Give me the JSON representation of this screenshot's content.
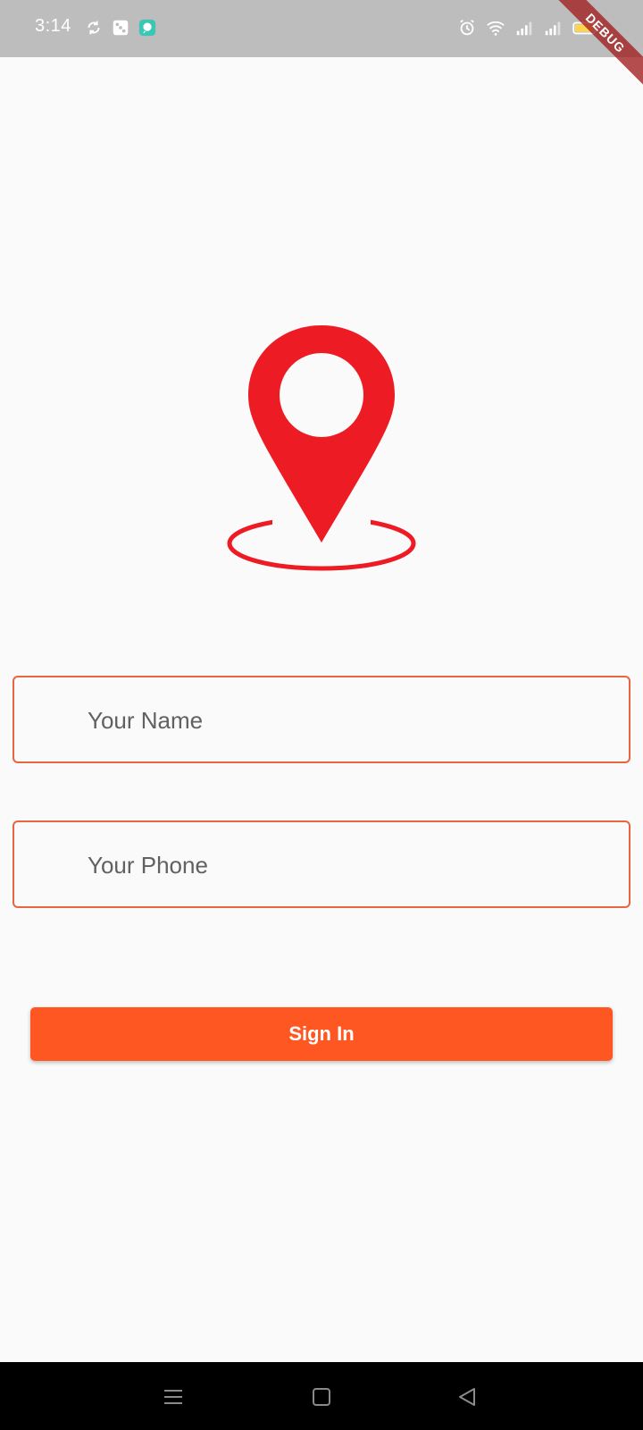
{
  "status_bar": {
    "time": "3:14",
    "left_icons": [
      "sync-icon",
      "dice-icon",
      "chat-icon"
    ],
    "right_icons": [
      "alarm-icon",
      "wifi-icon",
      "signal-icon",
      "signal-icon",
      "battery-icon"
    ]
  },
  "debug_banner": {
    "label": "DEBUG"
  },
  "logo": {
    "icon": "location-pin-icon",
    "color": "#ed1c24"
  },
  "form": {
    "name_placeholder": "Your Name",
    "name_value": "",
    "phone_placeholder": "Your Phone",
    "phone_value": "",
    "border_color": "#e8663d"
  },
  "signin_button": {
    "label": "Sign In",
    "color": "#ff5722"
  },
  "nav_bar": {
    "buttons": [
      "menu-icon",
      "home-icon",
      "back-icon"
    ]
  }
}
